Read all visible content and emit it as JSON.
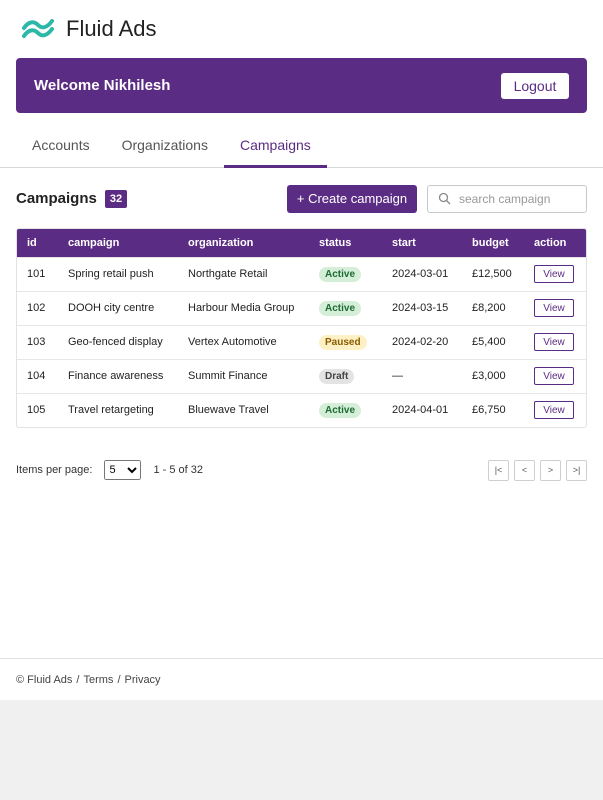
{
  "brand": {
    "name": "Fluid Ads",
    "accent": "#5b2c83",
    "logo_color": "#2bb8a8"
  },
  "welcome": {
    "text": "Welcome Nikhilesh",
    "logout_label": "Logout"
  },
  "tabs": [
    {
      "label": "Accounts",
      "active": false
    },
    {
      "label": "Organizations",
      "active": false
    },
    {
      "label": "Campaigns",
      "active": true
    }
  ],
  "toolbar": {
    "title": "Campaigns",
    "count": "32",
    "create_label": "+ Create campaign",
    "search_placeholder": "search campaign",
    "search_value": ""
  },
  "table": {
    "headers": [
      "id",
      "campaign",
      "organization",
      "status",
      "start",
      "budget",
      "action"
    ],
    "rows": [
      {
        "id": "101",
        "campaign": "Spring retail push",
        "organization": "Northgate Retail",
        "status": "Active",
        "start": "2024-03-01",
        "budget": "£12,500",
        "action": "View"
      },
      {
        "id": "102",
        "campaign": "DOOH city centre",
        "organization": "Harbour Media Group",
        "status": "Active",
        "start": "2024-03-15",
        "budget": "£8,200",
        "action": "View"
      },
      {
        "id": "103",
        "campaign": "Geo-fenced display",
        "organization": "Vertex Automotive",
        "status": "Paused",
        "start": "2024-02-20",
        "budget": "£5,400",
        "action": "View"
      },
      {
        "id": "104",
        "campaign": "Finance awareness",
        "organization": "Summit Finance",
        "status": "Draft",
        "start": "—",
        "budget": "£3,000",
        "action": "View"
      },
      {
        "id": "105",
        "campaign": "Travel retargeting",
        "organization": "Bluewave Travel",
        "status": "Active",
        "start": "2024-04-01",
        "budget": "£6,750",
        "action": "View"
      }
    ]
  },
  "pager": {
    "items_label": "Items per page:",
    "per_page": "5",
    "range": "1 - 5 of 32",
    "first": "|<",
    "prev": "<",
    "next": ">",
    "last": ">|"
  },
  "footer": {
    "copyright": "© Fluid Ads",
    "sep": "/",
    "terms": "Terms",
    "privacy": "Privacy"
  }
}
